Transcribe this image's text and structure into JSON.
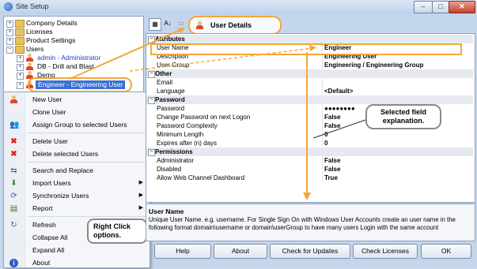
{
  "window": {
    "title": "Site Setup",
    "minimize": "–",
    "maximize": "□",
    "close": "✕"
  },
  "tree": {
    "items": [
      {
        "label": "Company Details",
        "icon": "folder-icon"
      },
      {
        "label": "Licenses",
        "icon": "folder-icon"
      },
      {
        "label": "Product Settings",
        "icon": "folder-icon"
      },
      {
        "label": "Users",
        "icon": "folder-icon"
      },
      {
        "label": "admin - Administrator",
        "icon": "user-icon"
      },
      {
        "label": "DB - Drill and Blast",
        "icon": "user-icon"
      },
      {
        "label": "Demo",
        "icon": "user-icon"
      },
      {
        "label": "Engineer - Engineering User",
        "icon": "user-icon"
      }
    ]
  },
  "context_menu": {
    "items": [
      {
        "label": "New User",
        "icon": "user-icon"
      },
      {
        "label": "Clone User",
        "icon": ""
      },
      {
        "label": "Assign Group to selected Users",
        "icon": "group-icon"
      },
      {
        "label": "Delete User",
        "icon": "delete-icon"
      },
      {
        "label": "Delete selected Users",
        "icon": "delete-icon"
      },
      {
        "label": "Search and Replace",
        "icon": "search-replace-icon"
      },
      {
        "label": "Import Users",
        "icon": "import-icon"
      },
      {
        "label": "Synchronize Users",
        "icon": "sync-icon"
      },
      {
        "label": "Report",
        "icon": "report-icon"
      },
      {
        "label": "Refresh",
        "icon": "refresh-icon"
      },
      {
        "label": "Collapse All",
        "icon": ""
      },
      {
        "label": "Expand All",
        "icon": ""
      },
      {
        "label": "About",
        "icon": "info-icon"
      }
    ]
  },
  "callouts": {
    "right_click": "Right Click options.",
    "selected_field": "Selected field explanation."
  },
  "toolbar": {
    "title": "User Details"
  },
  "properties": {
    "categories": [
      {
        "name": "Attributes",
        "rows": [
          {
            "key": "User Name",
            "value": "Engineer"
          },
          {
            "key": "Description",
            "value": "Engineering User"
          },
          {
            "key": "User Group",
            "value": "Engineering / Engineering Group"
          }
        ]
      },
      {
        "name": "Other",
        "rows": [
          {
            "key": "Email",
            "value": ""
          },
          {
            "key": "Language",
            "value": "<Default>"
          }
        ]
      },
      {
        "name": "Password",
        "rows": [
          {
            "key": "Password",
            "value": "●●●●●●●●"
          },
          {
            "key": "Change Password on next Logon",
            "value": "False"
          },
          {
            "key": "Password Complexity",
            "value": "False"
          },
          {
            "key": "Minimum Length",
            "value": "0"
          },
          {
            "key": "Expires after (n) days",
            "value": "0"
          }
        ]
      },
      {
        "name": "Permissions",
        "rows": [
          {
            "key": "Administrator",
            "value": "False"
          },
          {
            "key": "Disabled",
            "value": "False"
          },
          {
            "key": "Allow Web Channel Dashboard",
            "value": "True"
          }
        ]
      }
    ]
  },
  "description": {
    "title": "User Name",
    "text": "Unique User Name.  e.g. username.  For Single Sign On with Windows User Accounts create an user name in the following format domain\\username or domain\\userGroup to have many users Login with the same account"
  },
  "buttons": {
    "help": "Help",
    "about": "About",
    "check_updates": "Check for Updates",
    "check_licenses": "Check Licenses",
    "ok": "OK"
  },
  "colors": {
    "highlight": "#f3a63a",
    "selection": "#3a6fd8"
  }
}
